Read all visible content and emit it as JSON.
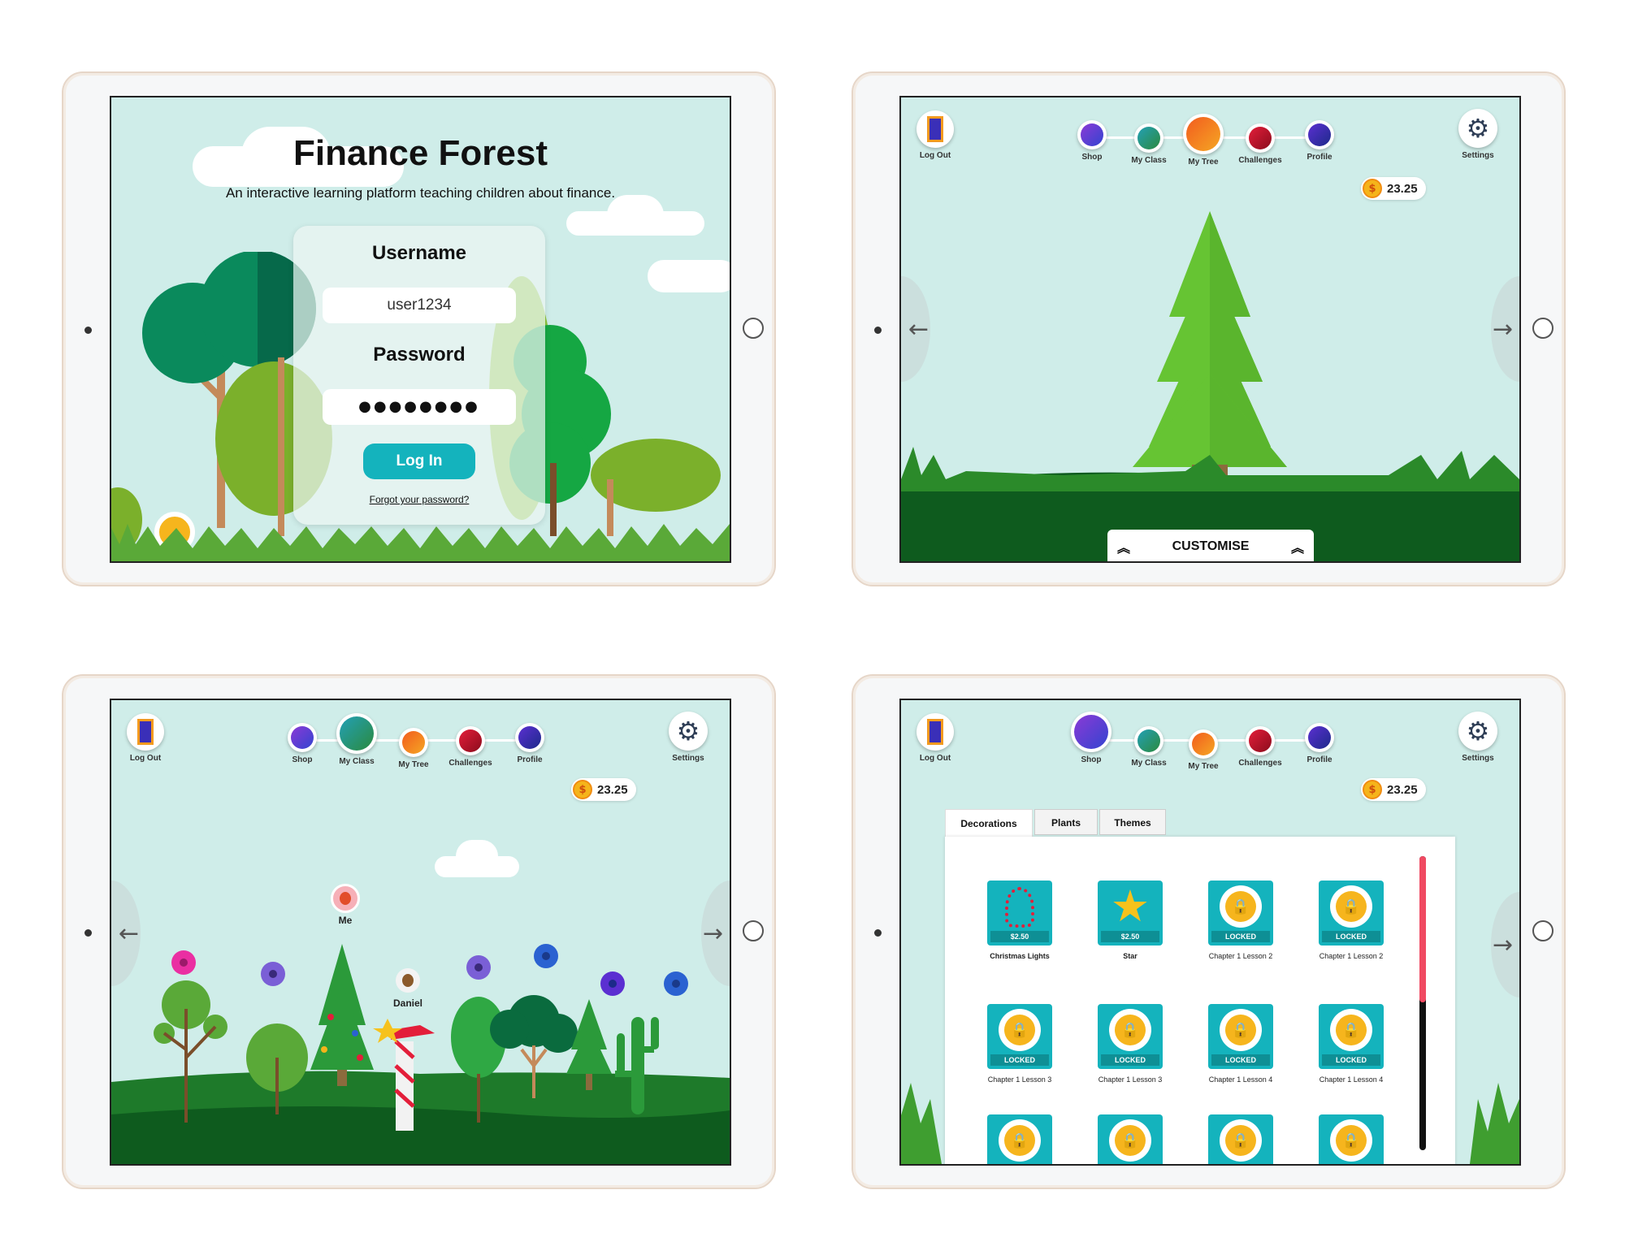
{
  "login": {
    "title": "Finance Forest",
    "subtitle": "An interactive learning platform teaching children about finance.",
    "username_label": "Username",
    "username_value": "user1234",
    "password_label": "Password",
    "password_value": "●●●●●●●●",
    "login_button": "Log In",
    "forgot_link": "Forgot your password?"
  },
  "nav": {
    "logout": "Log Out",
    "shop": "Shop",
    "my_class": "My Class",
    "my_tree": "My Tree",
    "challenges": "Challenges",
    "profile": "Profile",
    "settings": "Settings",
    "balance": "23.25"
  },
  "tree_screen": {
    "customise": "CUSTOMISE"
  },
  "class_screen": {
    "me_label": "Me",
    "friend_label": "Daniel"
  },
  "shop_screen": {
    "tabs": [
      "Decorations",
      "Plants",
      "Themes"
    ],
    "items": [
      {
        "label": "Christmas Lights",
        "price": "$2.50",
        "locked": false,
        "icon": "christmas-lights-icon"
      },
      {
        "label": "Star",
        "price": "$2.50",
        "locked": false,
        "icon": "star-icon"
      },
      {
        "label": "Chapter 1 Lesson 2",
        "price": "LOCKED",
        "locked": true,
        "icon": "lock-icon"
      },
      {
        "label": "Chapter 1 Lesson 2",
        "price": "LOCKED",
        "locked": true,
        "icon": "lock-icon"
      },
      {
        "label": "Chapter 1 Lesson 3",
        "price": "LOCKED",
        "locked": true,
        "icon": "lock-icon"
      },
      {
        "label": "Chapter 1 Lesson 3",
        "price": "LOCKED",
        "locked": true,
        "icon": "lock-icon"
      },
      {
        "label": "Chapter 1 Lesson 4",
        "price": "LOCKED",
        "locked": true,
        "icon": "lock-icon"
      },
      {
        "label": "Chapter 1 Lesson 4",
        "price": "LOCKED",
        "locked": true,
        "icon": "lock-icon"
      }
    ]
  },
  "colors": {
    "sky": "#cfede9",
    "accent": "#14b3bd",
    "grass": "#1e7a2a"
  }
}
